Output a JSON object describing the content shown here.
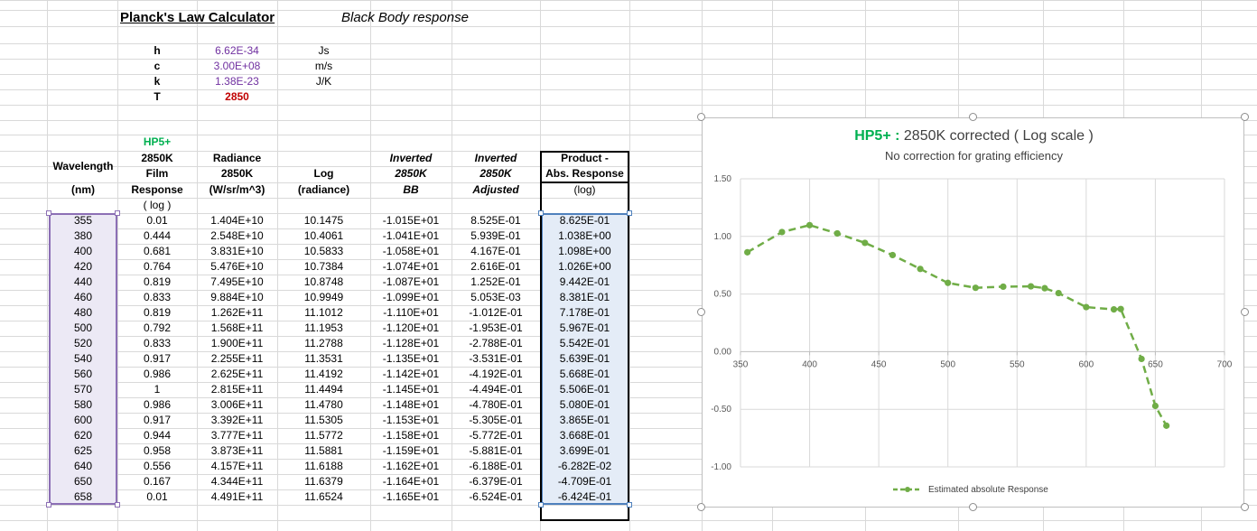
{
  "sheet": {
    "title": "Planck's Law Calculator",
    "subtitle": "Black Body response",
    "constants": [
      {
        "name": "h",
        "value": "6.62E-34",
        "unit": "Js"
      },
      {
        "name": "c",
        "value": "3.00E+08",
        "unit": "m/s"
      },
      {
        "name": "k",
        "value": "1.38E-23",
        "unit": "J/K"
      },
      {
        "name": "T",
        "value": "2850",
        "unit": ""
      }
    ],
    "headers": {
      "wavelength": [
        "Wavelength",
        "(nm)"
      ],
      "film": [
        "HP5+",
        "2850K",
        "Film",
        "Response",
        "( log )"
      ],
      "radiance": [
        "Radiance",
        "2850K",
        "(W/sr/m^3)"
      ],
      "log": [
        "Log",
        "(radiance)"
      ],
      "inv_bb": [
        "Inverted",
        "2850K",
        "BB"
      ],
      "inv_adj": [
        "Inverted",
        "2850K",
        "Adjusted"
      ],
      "product": [
        "Product -",
        "Abs. Response",
        "(log)"
      ]
    },
    "rows": [
      [
        "355",
        "0.01",
        "1.404E+10",
        "10.1475",
        "-1.015E+01",
        "8.525E-01",
        "8.625E-01"
      ],
      [
        "380",
        "0.444",
        "2.548E+10",
        "10.4061",
        "-1.041E+01",
        "5.939E-01",
        "1.038E+00"
      ],
      [
        "400",
        "0.681",
        "3.831E+10",
        "10.5833",
        "-1.058E+01",
        "4.167E-01",
        "1.098E+00"
      ],
      [
        "420",
        "0.764",
        "5.476E+10",
        "10.7384",
        "-1.074E+01",
        "2.616E-01",
        "1.026E+00"
      ],
      [
        "440",
        "0.819",
        "7.495E+10",
        "10.8748",
        "-1.087E+01",
        "1.252E-01",
        "9.442E-01"
      ],
      [
        "460",
        "0.833",
        "9.884E+10",
        "10.9949",
        "-1.099E+01",
        "5.053E-03",
        "8.381E-01"
      ],
      [
        "480",
        "0.819",
        "1.262E+11",
        "11.1012",
        "-1.110E+01",
        "-1.012E-01",
        "7.178E-01"
      ],
      [
        "500",
        "0.792",
        "1.568E+11",
        "11.1953",
        "-1.120E+01",
        "-1.953E-01",
        "5.967E-01"
      ],
      [
        "520",
        "0.833",
        "1.900E+11",
        "11.2788",
        "-1.128E+01",
        "-2.788E-01",
        "5.542E-01"
      ],
      [
        "540",
        "0.917",
        "2.255E+11",
        "11.3531",
        "-1.135E+01",
        "-3.531E-01",
        "5.639E-01"
      ],
      [
        "560",
        "0.986",
        "2.625E+11",
        "11.4192",
        "-1.142E+01",
        "-4.192E-01",
        "5.668E-01"
      ],
      [
        "570",
        "1",
        "2.815E+11",
        "11.4494",
        "-1.145E+01",
        "-4.494E-01",
        "5.506E-01"
      ],
      [
        "580",
        "0.986",
        "3.006E+11",
        "11.4780",
        "-1.148E+01",
        "-4.780E-01",
        "5.080E-01"
      ],
      [
        "600",
        "0.917",
        "3.392E+11",
        "11.5305",
        "-1.153E+01",
        "-5.305E-01",
        "3.865E-01"
      ],
      [
        "620",
        "0.944",
        "3.777E+11",
        "11.5772",
        "-1.158E+01",
        "-5.772E-01",
        "3.668E-01"
      ],
      [
        "625",
        "0.958",
        "3.873E+11",
        "11.5881",
        "-1.159E+01",
        "-5.881E-01",
        "3.699E-01"
      ],
      [
        "640",
        "0.556",
        "4.157E+11",
        "11.6188",
        "-1.162E+01",
        "-6.188E-01",
        "-6.282E-02"
      ],
      [
        "650",
        "0.167",
        "4.344E+11",
        "11.6379",
        "-1.164E+01",
        "-6.379E-01",
        "-4.709E-01"
      ],
      [
        "658",
        "0.01",
        "4.491E+11",
        "11.6524",
        "-1.165E+01",
        "-6.524E-01",
        "-6.424E-01"
      ]
    ]
  },
  "colors": {
    "accent_green": "#00b050",
    "constant_purple": "#7030a0",
    "temperature_red": "#c00000",
    "series_green": "#70ad47",
    "selection_blue": "#4f81bd",
    "selection_purple": "#8c6fb5"
  },
  "chart_data": {
    "type": "line",
    "title_bold": "HP5+ :",
    "title_rest": " 2850K corrected ( Log scale )",
    "subtitle": "No correction for grating efficiency",
    "xlabel": "",
    "ylabel": "",
    "xlim": [
      350,
      700
    ],
    "ylim": [
      -1.0,
      1.5
    ],
    "x_ticks": [
      "350",
      "400",
      "450",
      "500",
      "550",
      "600",
      "650",
      "700"
    ],
    "y_ticks": [
      "1.50",
      "1.00",
      "0.50",
      "0.00",
      "-0.50",
      "-1.00"
    ],
    "grid": true,
    "legend_position": "bottom",
    "series": [
      {
        "name": "Estimated absolute Response",
        "style": "dashed line with circle markers",
        "x": [
          355,
          380,
          400,
          420,
          440,
          460,
          480,
          500,
          520,
          540,
          560,
          570,
          580,
          600,
          620,
          625,
          640,
          650,
          658
        ],
        "y": [
          0.8625,
          1.038,
          1.098,
          1.026,
          0.9442,
          0.8381,
          0.7178,
          0.5967,
          0.5542,
          0.5639,
          0.5668,
          0.5506,
          0.508,
          0.3865,
          0.3668,
          0.3699,
          -0.06282,
          -0.4709,
          -0.6424
        ]
      }
    ]
  }
}
